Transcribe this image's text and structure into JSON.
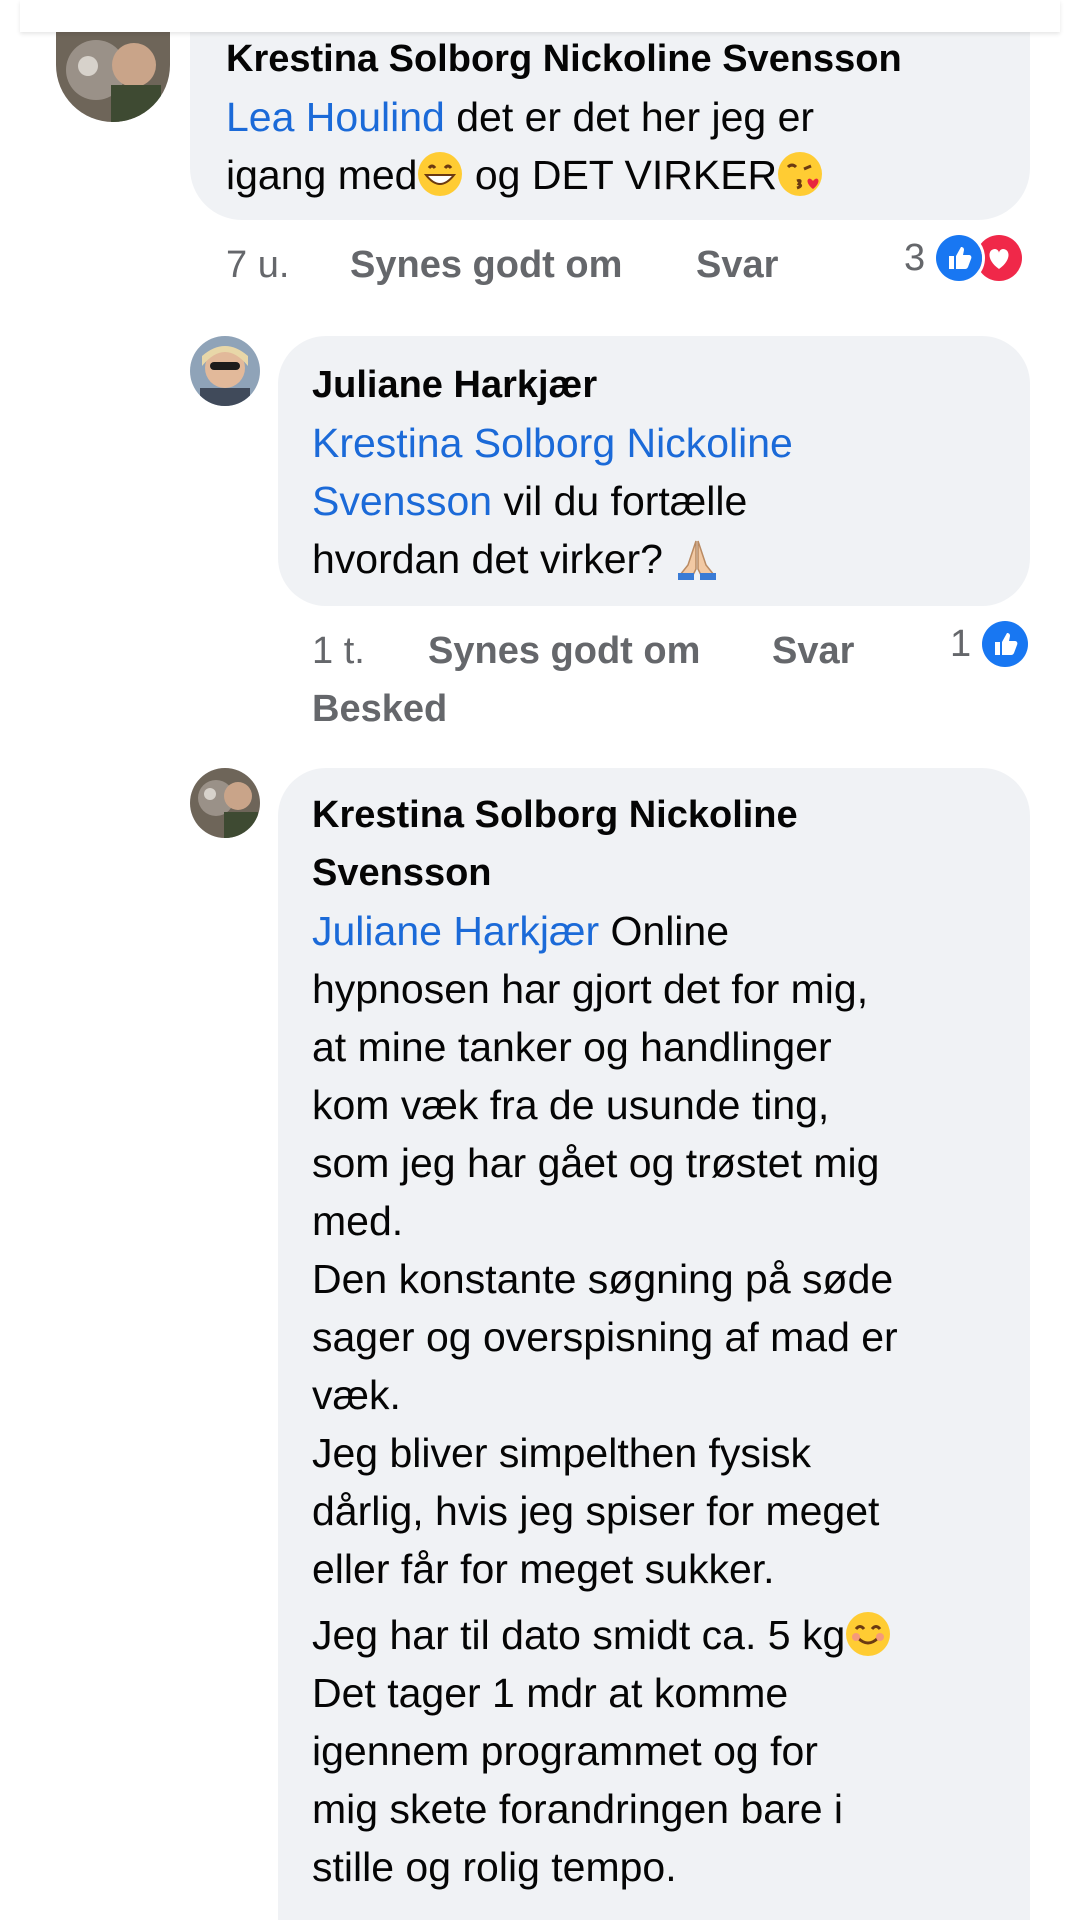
{
  "comments": [
    {
      "author": "Krestina Solborg Nickoline Svensson",
      "mention": "Lea Houlind",
      "text_line1": " det er det her jeg er",
      "text_line2a": "igang med",
      "text_line2b": " og DET VIRKER",
      "emoji_1": "grinning-face-emoji",
      "emoji_2": "kissing-face-emoji",
      "time": "7 u.",
      "like_label": "Synes godt om",
      "reply_label": "Svar",
      "reaction_count": "3",
      "reactions": [
        "like-icon",
        "love-icon"
      ]
    },
    {
      "author": "Juliane Harkjær",
      "mention_line1": "Krestina Solborg Nickoline",
      "mention_line2": "Svensson",
      "text_line2": "  vil du fortælle",
      "text_line3": "hvordan det virker? ",
      "emoji_1": "folded-hands-emoji",
      "time": "1 t.",
      "like_label": "Synes godt om",
      "reply_label": "Svar",
      "message_label": "Besked",
      "reaction_count": "1",
      "reactions": [
        "like-icon"
      ]
    },
    {
      "author_line1": "Krestina Solborg Nickoline",
      "author_line2": "Svensson",
      "mention": "Juliane Harkjær",
      "first_line": " Online",
      "lines": [
        "hypnosen har gjort det for mig,",
        "at mine tanker og handlinger",
        "kom væk fra de usunde ting,",
        "som jeg har gået og trøstet mig",
        "med.",
        "Den konstante søgning på søde",
        "sager og overspisning af mad er",
        "væk.",
        "Jeg bliver simpelthen fysisk",
        "dårlig, hvis jeg spiser for meget",
        "eller får for meget sukker."
      ],
      "weight_line": "Jeg har til dato smidt ca. 5 kg",
      "emoji_1": "smiling-face-emoji",
      "tail_lines": [
        "Det tager 1 mdr at komme",
        "igennem programmet og for",
        "mig skete forandringen bare i",
        "stille og rolig tempo."
      ]
    }
  ],
  "colors": {
    "bubble": "#f0f2f5",
    "mention": "#1b6ad8",
    "meta": "#65676b",
    "like_blue": "#1877f2",
    "love_red": "#f02849"
  }
}
